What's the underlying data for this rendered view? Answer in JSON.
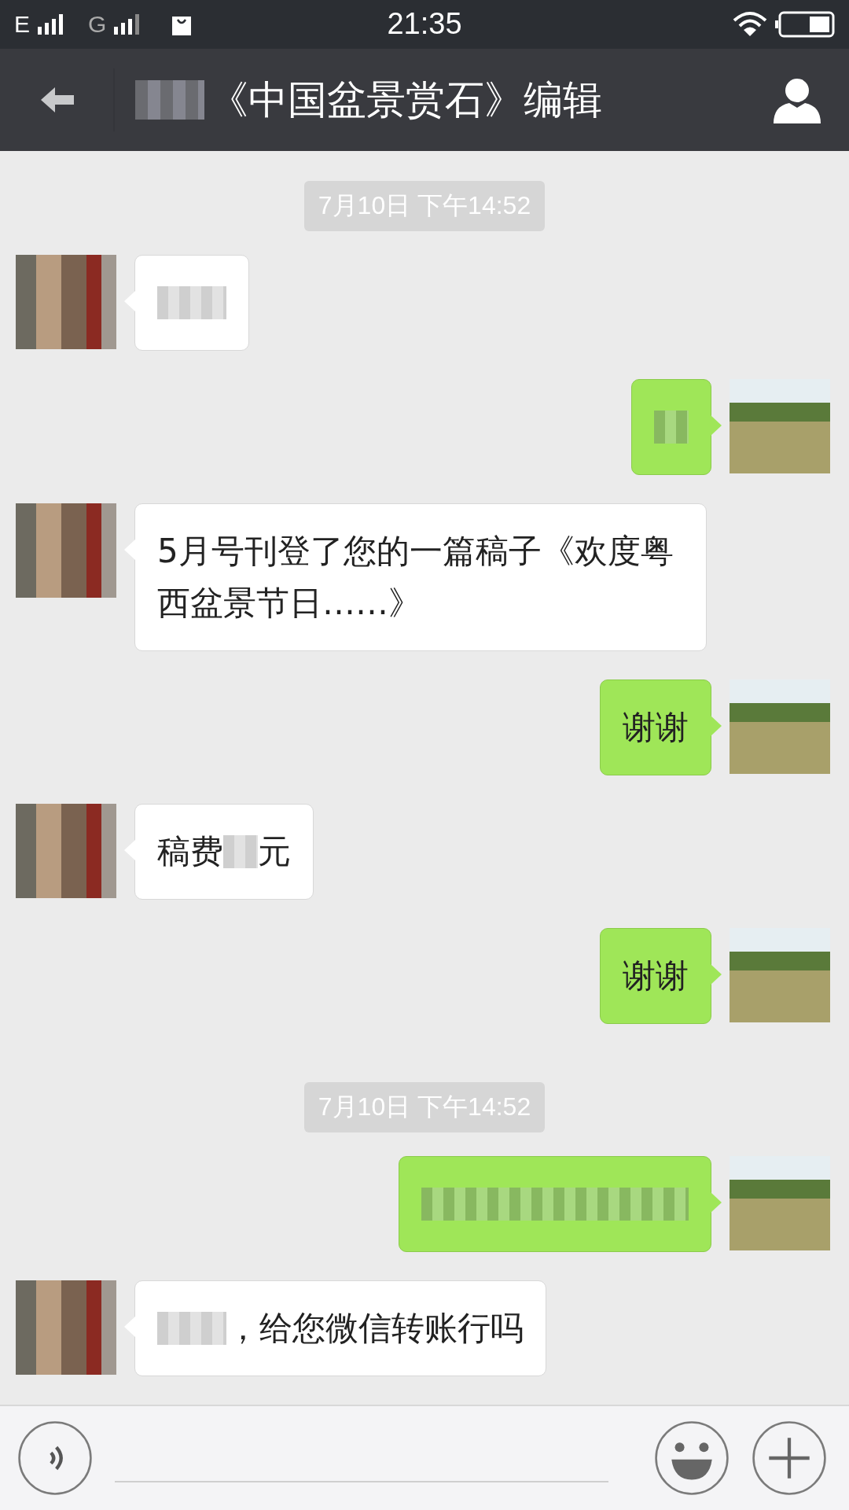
{
  "status_bar": {
    "carrier_1": "E",
    "carrier_2": "G",
    "time": "21:35"
  },
  "header": {
    "title_parts": [
      {
        "kind": "redacted_medium"
      },
      {
        "kind": "text",
        "text": "《中国盆景赏石》编辑"
      }
    ]
  },
  "messages": [
    {
      "kind": "timestamp",
      "text": "7月10日 下午14:52"
    },
    {
      "kind": "received",
      "parts": [
        {
          "kind": "redacted_medium"
        }
      ]
    },
    {
      "kind": "sent",
      "parts": [
        {
          "kind": "redacted_short"
        }
      ]
    },
    {
      "kind": "received",
      "parts": [
        {
          "kind": "text",
          "text": "5月号刊登了您的一篇稿子《欢度粤西盆景节日……》"
        }
      ]
    },
    {
      "kind": "sent",
      "parts": [
        {
          "kind": "text",
          "text": "谢谢"
        }
      ]
    },
    {
      "kind": "received",
      "parts": [
        {
          "kind": "text",
          "text": "稿费"
        },
        {
          "kind": "redacted_short"
        },
        {
          "kind": "text",
          "text": "元"
        }
      ]
    },
    {
      "kind": "sent",
      "parts": [
        {
          "kind": "text",
          "text": "谢谢"
        }
      ]
    },
    {
      "kind": "timestamp",
      "text": "7月10日 下午14:52"
    },
    {
      "kind": "sent",
      "parts": [
        {
          "kind": "redacted_long"
        }
      ]
    },
    {
      "kind": "received",
      "parts": [
        {
          "kind": "redacted_medium"
        },
        {
          "kind": "text",
          "text": "，给您微信转账行吗"
        }
      ]
    }
  ]
}
